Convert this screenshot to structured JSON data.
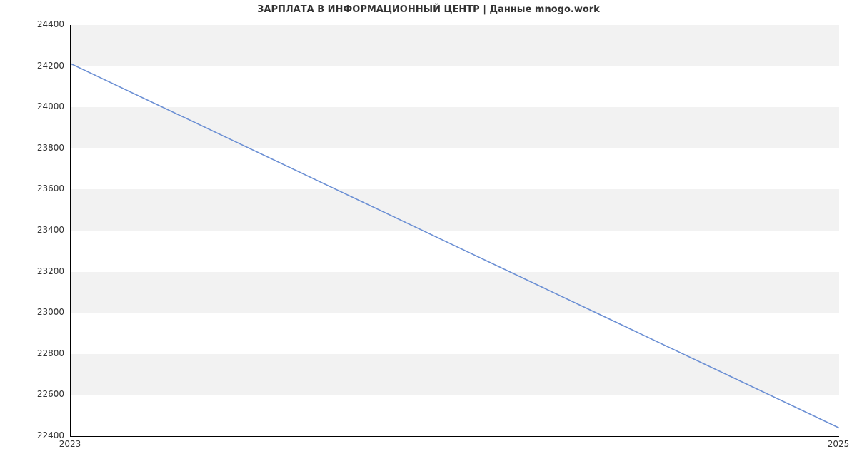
{
  "chart_data": {
    "type": "line",
    "title": "ЗАРПЛАТА В ИНФОРМАЦИОННЫЙ ЦЕНТР | Данные mnogo.work",
    "xlabel": "",
    "ylabel": "",
    "x": [
      2023,
      2025
    ],
    "values": [
      24212,
      22440
    ],
    "x_ticks": [
      2023,
      2025
    ],
    "y_ticks": [
      22400,
      22600,
      22800,
      23000,
      23200,
      23400,
      23600,
      23800,
      24000,
      24200,
      24400
    ],
    "xlim": [
      2023,
      2025
    ],
    "ylim": [
      22400,
      24400
    ],
    "line_color": "#6b8fd4",
    "band_color": "#f2f2f2"
  }
}
